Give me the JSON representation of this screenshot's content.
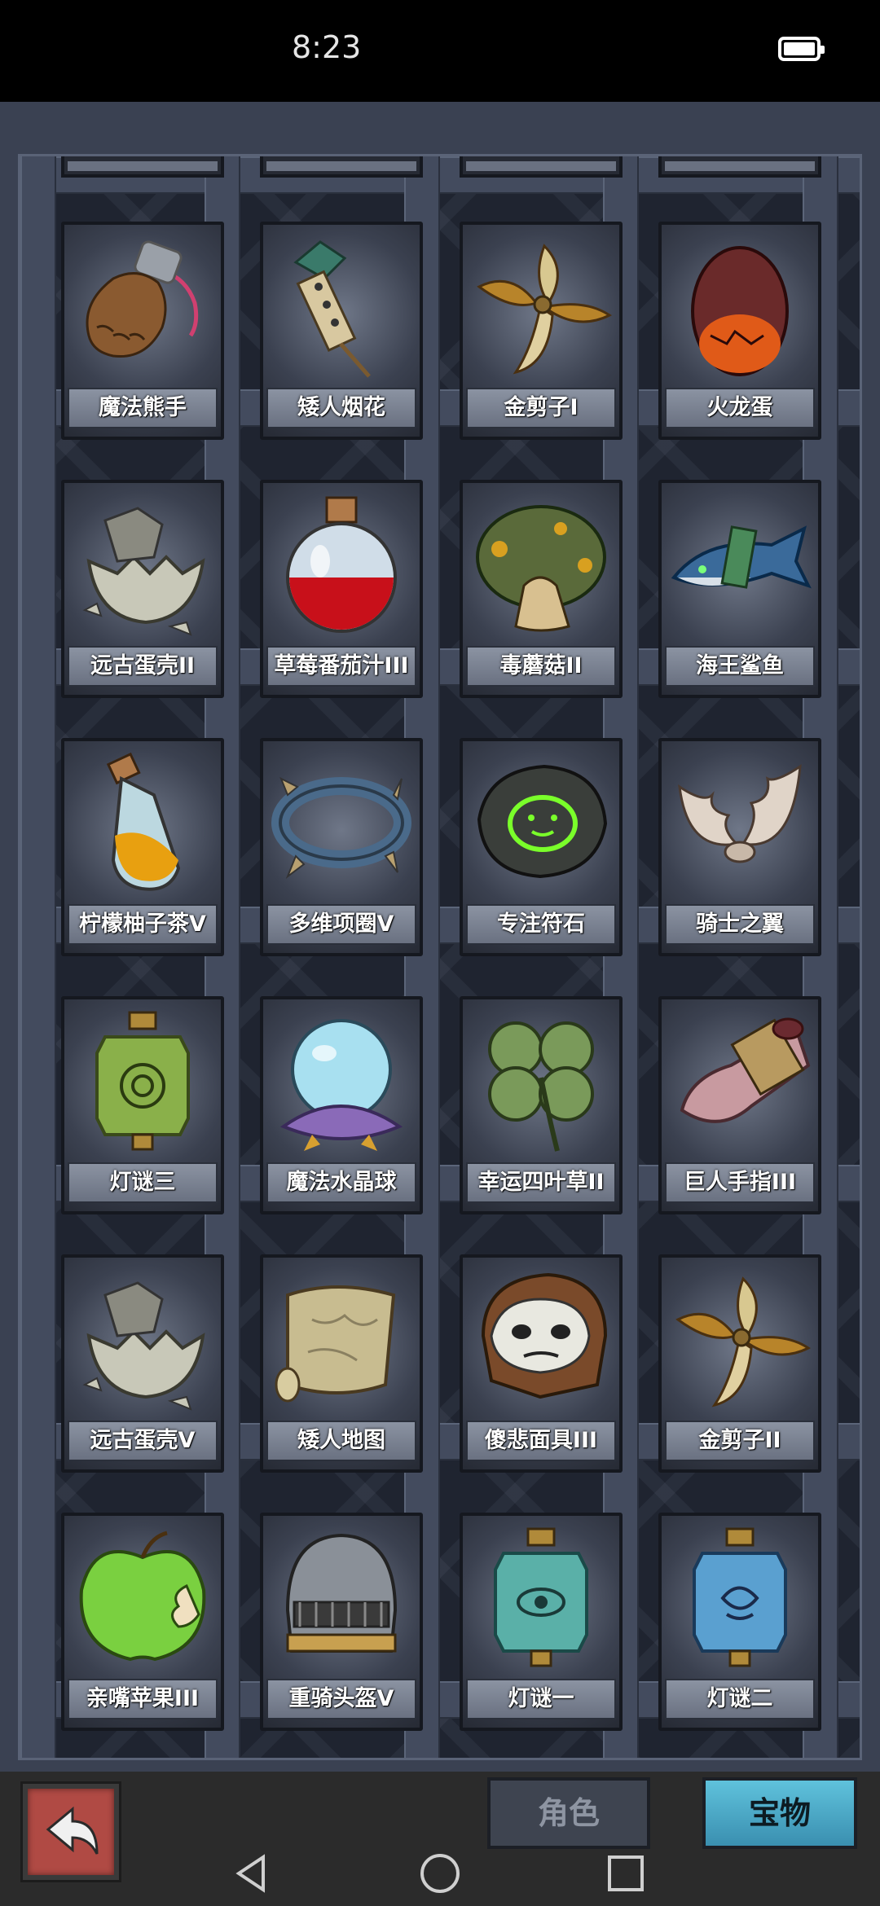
{
  "status": {
    "time": "8:23"
  },
  "items": [
    [
      {
        "label": "魔法熊手",
        "icon": "bear-paw-icon"
      },
      {
        "label": "矮人烟花",
        "icon": "firework-icon"
      },
      {
        "label": "金剪子I",
        "icon": "gold-scissors-icon"
      },
      {
        "label": "火龙蛋",
        "icon": "dragon-egg-icon"
      }
    ],
    [
      {
        "label": "远古蛋壳II",
        "icon": "eggshell-icon"
      },
      {
        "label": "草莓番茄汁III",
        "icon": "potion-flask-icon"
      },
      {
        "label": "毒蘑菇II",
        "icon": "poison-mushroom-icon"
      },
      {
        "label": "海王鲨鱼",
        "icon": "shark-icon"
      }
    ],
    [
      {
        "label": "柠檬柚子茶V",
        "icon": "tea-bottle-icon"
      },
      {
        "label": "多维项圈V",
        "icon": "collar-icon"
      },
      {
        "label": "专注符石",
        "icon": "rune-stone-icon"
      },
      {
        "label": "骑士之翼",
        "icon": "wings-icon"
      }
    ],
    [
      {
        "label": "灯谜三",
        "icon": "lantern-green-icon"
      },
      {
        "label": "魔法水晶球",
        "icon": "crystal-ball-icon"
      },
      {
        "label": "幸运四叶草II",
        "icon": "clover-icon"
      },
      {
        "label": "巨人手指III",
        "icon": "giant-finger-icon"
      }
    ],
    [
      {
        "label": "远古蛋壳V",
        "icon": "eggshell-icon"
      },
      {
        "label": "矮人地图",
        "icon": "map-scroll-icon"
      },
      {
        "label": "傻悲面具III",
        "icon": "mask-icon"
      },
      {
        "label": "金剪子II",
        "icon": "gold-scissors-icon"
      }
    ],
    [
      {
        "label": "亲嘴苹果III",
        "icon": "apple-icon"
      },
      {
        "label": "重骑头盔V",
        "icon": "knight-helmet-icon"
      },
      {
        "label": "灯谜一",
        "icon": "lantern-teal-icon"
      },
      {
        "label": "灯谜二",
        "icon": "lantern-blue-icon"
      }
    ]
  ],
  "tabs": {
    "role": "角色",
    "treasure": "宝物"
  },
  "colors": {
    "frame": "#3a4152",
    "label": "#7a8190",
    "active_tab": "#4aa8c8",
    "back_button": "#b04a44"
  }
}
